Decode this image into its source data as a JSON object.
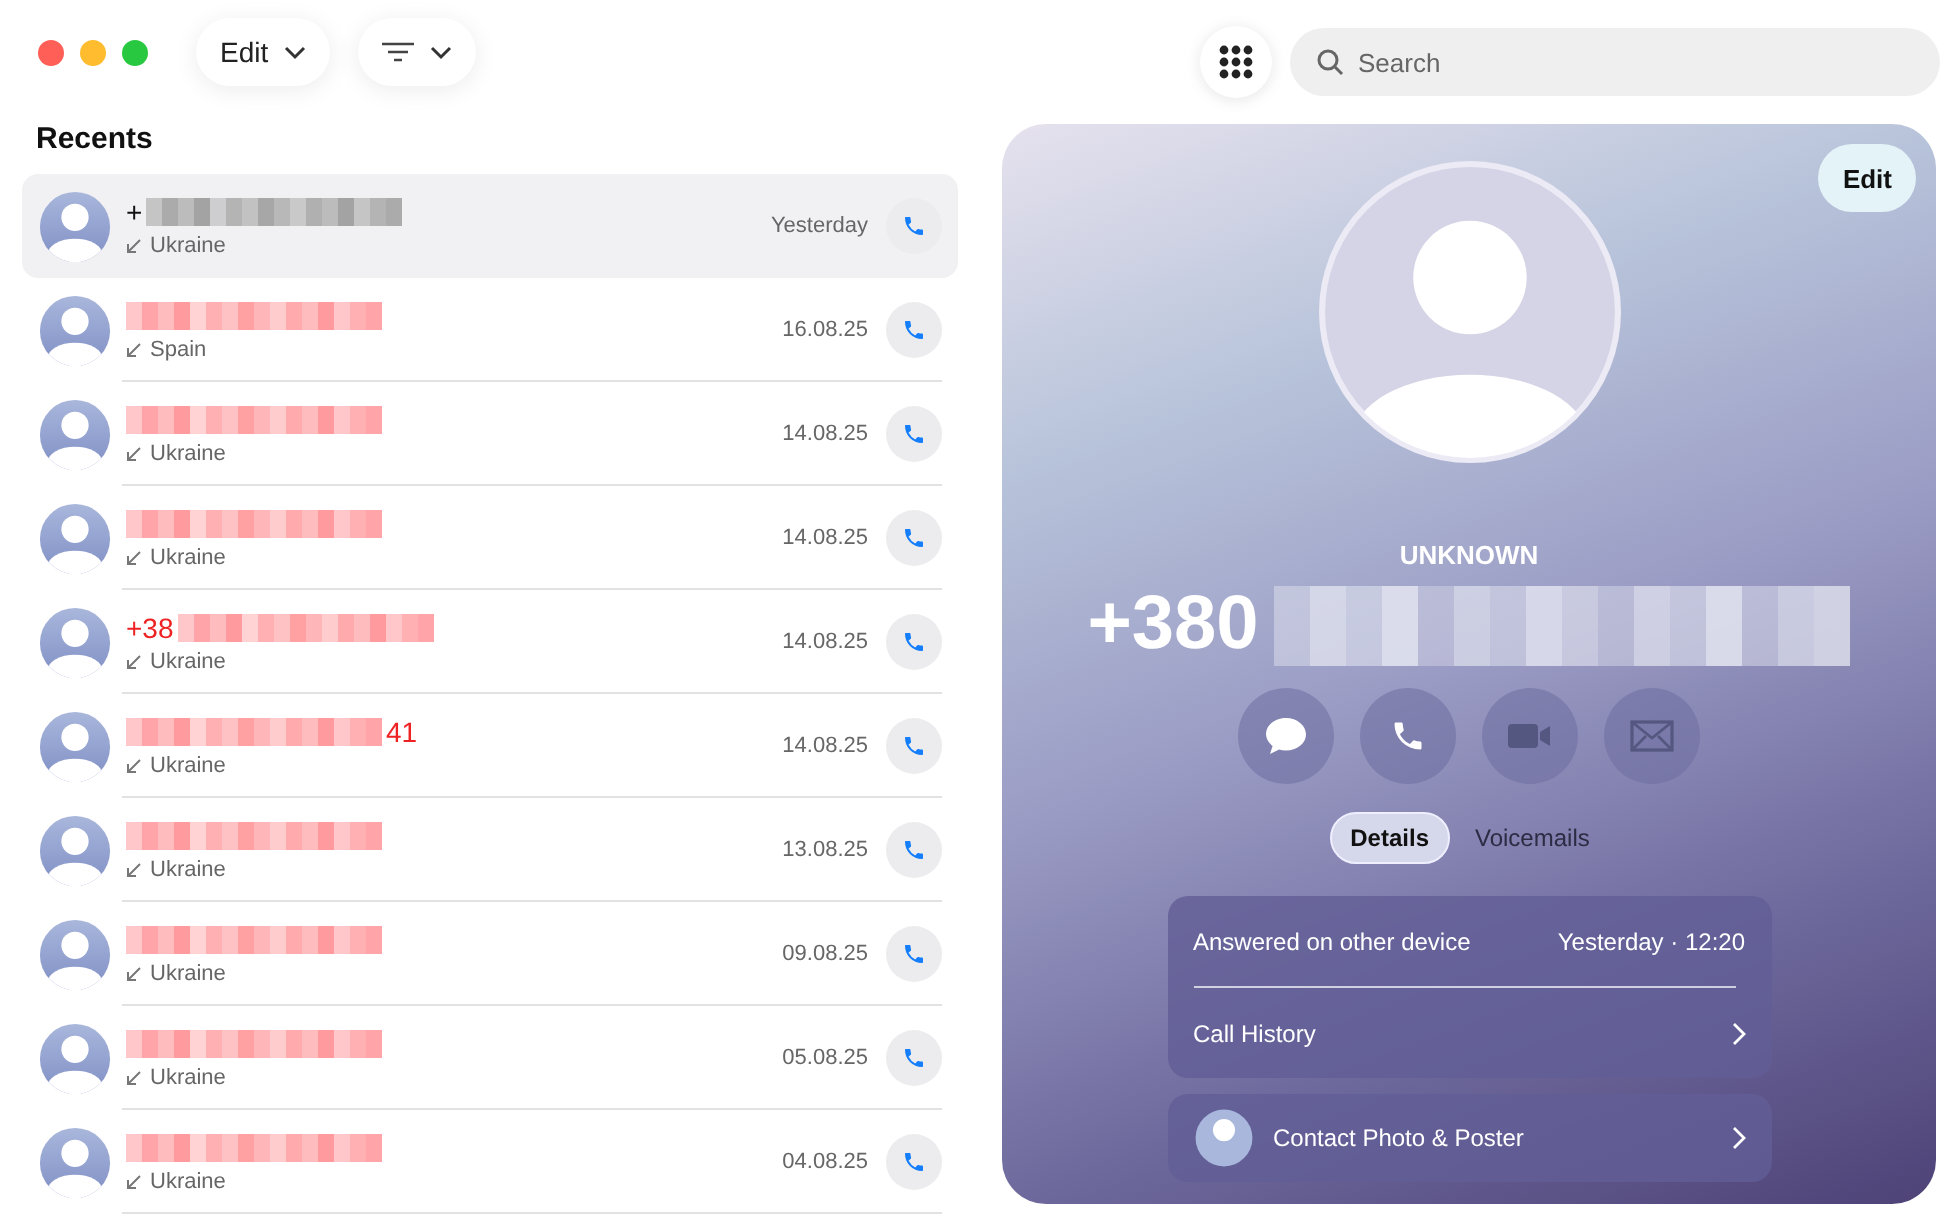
{
  "toolbar": {
    "edit_button": "Edit",
    "search": {
      "placeholder": "Search"
    }
  },
  "recents": {
    "title": "Recents",
    "rows": [
      {
        "name_start": "+",
        "name_end": "",
        "missed": false,
        "place": "Ukraine",
        "date": "Yesterday",
        "selected": true
      },
      {
        "name_start": "",
        "name_end": "",
        "missed": true,
        "place": "Spain",
        "date": "16.08.25",
        "selected": false
      },
      {
        "name_start": "",
        "name_end": "",
        "missed": true,
        "place": "Ukraine",
        "date": "14.08.25",
        "selected": false
      },
      {
        "name_start": "",
        "name_end": "",
        "missed": true,
        "place": "Ukraine",
        "date": "14.08.25",
        "selected": false
      },
      {
        "name_start": "+38",
        "name_end": "",
        "missed": true,
        "place": "Ukraine",
        "date": "14.08.25",
        "selected": false
      },
      {
        "name_start": "",
        "name_end": "41",
        "missed": true,
        "place": "Ukraine",
        "date": "14.08.25",
        "selected": false
      },
      {
        "name_start": "",
        "name_end": "",
        "missed": true,
        "place": "Ukraine",
        "date": "13.08.25",
        "selected": false
      },
      {
        "name_start": "",
        "name_end": "",
        "missed": true,
        "place": "Ukraine",
        "date": "09.08.25",
        "selected": false
      },
      {
        "name_start": "",
        "name_end": "",
        "missed": true,
        "place": "Ukraine",
        "date": "05.08.25",
        "selected": false
      },
      {
        "name_start": "",
        "name_end": "",
        "missed": true,
        "place": "Ukraine",
        "date": "04.08.25",
        "selected": false
      }
    ]
  },
  "detail": {
    "edit_button": "Edit",
    "label": "UNKNOWN",
    "number_start": "+380",
    "actions": [
      {
        "kind": "message",
        "disabled": false
      },
      {
        "kind": "call",
        "disabled": false
      },
      {
        "kind": "video",
        "disabled": true
      },
      {
        "kind": "mail",
        "disabled": true
      }
    ],
    "tabs": [
      {
        "label": "Details",
        "selected": true
      },
      {
        "label": "Voicemails",
        "selected": false
      }
    ],
    "call_info": {
      "status": "Answered on other device",
      "time": "Yesterday · 12:20",
      "history_link": "Call History"
    },
    "contact_row": "Contact Photo & Poster"
  }
}
